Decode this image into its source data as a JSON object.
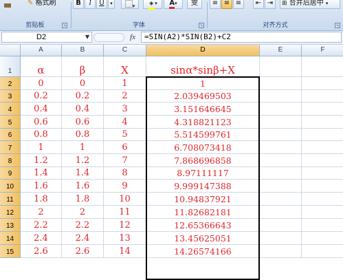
{
  "ribbon": {
    "clipboard": {
      "format_painter_label": "格式刷",
      "group_label": "剪贴板"
    },
    "font": {
      "bold_label": "B",
      "italic_label": "I",
      "underline_label": "U",
      "highlight_color": "#ffff00",
      "font_color": "#e0262c",
      "group_label": "字体"
    },
    "alignment": {
      "merge_center_label": "合并后居中",
      "group_label": "对齐方式"
    }
  },
  "formula_bar": {
    "name_box": "D2",
    "fx_label": "fx",
    "formula": "=SIN(A2)*SIN(B2)+C2"
  },
  "sheet": {
    "selected_col": "D",
    "columns": [
      "A",
      "B",
      "C",
      "D",
      "E",
      "F"
    ],
    "rows": [
      {
        "num": "1",
        "A": "α",
        "B": "β",
        "C": "X",
        "D": "sinα*sinβ+X"
      },
      {
        "num": "2",
        "A": "0",
        "B": "0",
        "C": "1",
        "D": "1"
      },
      {
        "num": "3",
        "A": "0.2",
        "B": "0.2",
        "C": "2",
        "D": "2.039469503"
      },
      {
        "num": "4",
        "A": "0.4",
        "B": "0.4",
        "C": "3",
        "D": "3.151646645"
      },
      {
        "num": "5",
        "A": "0.6",
        "B": "0.6",
        "C": "4",
        "D": "4.318821123"
      },
      {
        "num": "6",
        "A": "0.8",
        "B": "0.8",
        "C": "5",
        "D": "5.514599761"
      },
      {
        "num": "7",
        "A": "1",
        "B": "1",
        "C": "6",
        "D": "6.708073418"
      },
      {
        "num": "8",
        "A": "1.2",
        "B": "1.2",
        "C": "7",
        "D": "7.868696858"
      },
      {
        "num": "9",
        "A": "1.4",
        "B": "1.4",
        "C": "8",
        "D": "8.97111117"
      },
      {
        "num": "10",
        "A": "1.6",
        "B": "1.6",
        "C": "9",
        "D": "9.999147388"
      },
      {
        "num": "11",
        "A": "1.8",
        "B": "1.8",
        "C": "10",
        "D": "10.94837921"
      },
      {
        "num": "12",
        "A": "2",
        "B": "2",
        "C": "11",
        "D": "11.82682181"
      },
      {
        "num": "13",
        "A": "2.2",
        "B": "2.2",
        "C": "12",
        "D": "12.65366643"
      },
      {
        "num": "14",
        "A": "2.4",
        "B": "2.4",
        "C": "13",
        "D": "13.45625051"
      },
      {
        "num": "15",
        "A": "2.6",
        "B": "2.6",
        "C": "14",
        "D": "14.26574166"
      }
    ]
  },
  "colors": {
    "cell_text": "#e0262c",
    "selected_header": "#f1c15f",
    "grid_line": "#d0d7e5"
  }
}
